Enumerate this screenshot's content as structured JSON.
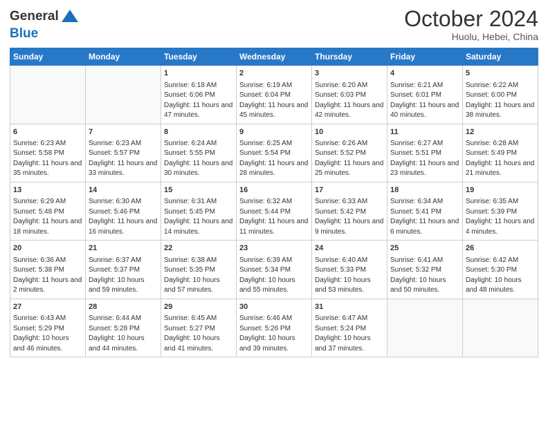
{
  "header": {
    "logo_general": "General",
    "logo_blue": "Blue",
    "title": "October 2024",
    "location": "Huolu, Hebei, China"
  },
  "days_of_week": [
    "Sunday",
    "Monday",
    "Tuesday",
    "Wednesday",
    "Thursday",
    "Friday",
    "Saturday"
  ],
  "weeks": [
    [
      {
        "day": "",
        "info": ""
      },
      {
        "day": "",
        "info": ""
      },
      {
        "day": "1",
        "info": "Sunrise: 6:18 AM\nSunset: 6:06 PM\nDaylight: 11 hours and 47 minutes."
      },
      {
        "day": "2",
        "info": "Sunrise: 6:19 AM\nSunset: 6:04 PM\nDaylight: 11 hours and 45 minutes."
      },
      {
        "day": "3",
        "info": "Sunrise: 6:20 AM\nSunset: 6:03 PM\nDaylight: 11 hours and 42 minutes."
      },
      {
        "day": "4",
        "info": "Sunrise: 6:21 AM\nSunset: 6:01 PM\nDaylight: 11 hours and 40 minutes."
      },
      {
        "day": "5",
        "info": "Sunrise: 6:22 AM\nSunset: 6:00 PM\nDaylight: 11 hours and 38 minutes."
      }
    ],
    [
      {
        "day": "6",
        "info": "Sunrise: 6:23 AM\nSunset: 5:58 PM\nDaylight: 11 hours and 35 minutes."
      },
      {
        "day": "7",
        "info": "Sunrise: 6:23 AM\nSunset: 5:57 PM\nDaylight: 11 hours and 33 minutes."
      },
      {
        "day": "8",
        "info": "Sunrise: 6:24 AM\nSunset: 5:55 PM\nDaylight: 11 hours and 30 minutes."
      },
      {
        "day": "9",
        "info": "Sunrise: 6:25 AM\nSunset: 5:54 PM\nDaylight: 11 hours and 28 minutes."
      },
      {
        "day": "10",
        "info": "Sunrise: 6:26 AM\nSunset: 5:52 PM\nDaylight: 11 hours and 25 minutes."
      },
      {
        "day": "11",
        "info": "Sunrise: 6:27 AM\nSunset: 5:51 PM\nDaylight: 11 hours and 23 minutes."
      },
      {
        "day": "12",
        "info": "Sunrise: 6:28 AM\nSunset: 5:49 PM\nDaylight: 11 hours and 21 minutes."
      }
    ],
    [
      {
        "day": "13",
        "info": "Sunrise: 6:29 AM\nSunset: 5:48 PM\nDaylight: 11 hours and 18 minutes."
      },
      {
        "day": "14",
        "info": "Sunrise: 6:30 AM\nSunset: 5:46 PM\nDaylight: 11 hours and 16 minutes."
      },
      {
        "day": "15",
        "info": "Sunrise: 6:31 AM\nSunset: 5:45 PM\nDaylight: 11 hours and 14 minutes."
      },
      {
        "day": "16",
        "info": "Sunrise: 6:32 AM\nSunset: 5:44 PM\nDaylight: 11 hours and 11 minutes."
      },
      {
        "day": "17",
        "info": "Sunrise: 6:33 AM\nSunset: 5:42 PM\nDaylight: 11 hours and 9 minutes."
      },
      {
        "day": "18",
        "info": "Sunrise: 6:34 AM\nSunset: 5:41 PM\nDaylight: 11 hours and 6 minutes."
      },
      {
        "day": "19",
        "info": "Sunrise: 6:35 AM\nSunset: 5:39 PM\nDaylight: 11 hours and 4 minutes."
      }
    ],
    [
      {
        "day": "20",
        "info": "Sunrise: 6:36 AM\nSunset: 5:38 PM\nDaylight: 11 hours and 2 minutes."
      },
      {
        "day": "21",
        "info": "Sunrise: 6:37 AM\nSunset: 5:37 PM\nDaylight: 10 hours and 59 minutes."
      },
      {
        "day": "22",
        "info": "Sunrise: 6:38 AM\nSunset: 5:35 PM\nDaylight: 10 hours and 57 minutes."
      },
      {
        "day": "23",
        "info": "Sunrise: 6:39 AM\nSunset: 5:34 PM\nDaylight: 10 hours and 55 minutes."
      },
      {
        "day": "24",
        "info": "Sunrise: 6:40 AM\nSunset: 5:33 PM\nDaylight: 10 hours and 53 minutes."
      },
      {
        "day": "25",
        "info": "Sunrise: 6:41 AM\nSunset: 5:32 PM\nDaylight: 10 hours and 50 minutes."
      },
      {
        "day": "26",
        "info": "Sunrise: 6:42 AM\nSunset: 5:30 PM\nDaylight: 10 hours and 48 minutes."
      }
    ],
    [
      {
        "day": "27",
        "info": "Sunrise: 6:43 AM\nSunset: 5:29 PM\nDaylight: 10 hours and 46 minutes."
      },
      {
        "day": "28",
        "info": "Sunrise: 6:44 AM\nSunset: 5:28 PM\nDaylight: 10 hours and 44 minutes."
      },
      {
        "day": "29",
        "info": "Sunrise: 6:45 AM\nSunset: 5:27 PM\nDaylight: 10 hours and 41 minutes."
      },
      {
        "day": "30",
        "info": "Sunrise: 6:46 AM\nSunset: 5:26 PM\nDaylight: 10 hours and 39 minutes."
      },
      {
        "day": "31",
        "info": "Sunrise: 6:47 AM\nSunset: 5:24 PM\nDaylight: 10 hours and 37 minutes."
      },
      {
        "day": "",
        "info": ""
      },
      {
        "day": "",
        "info": ""
      }
    ]
  ]
}
